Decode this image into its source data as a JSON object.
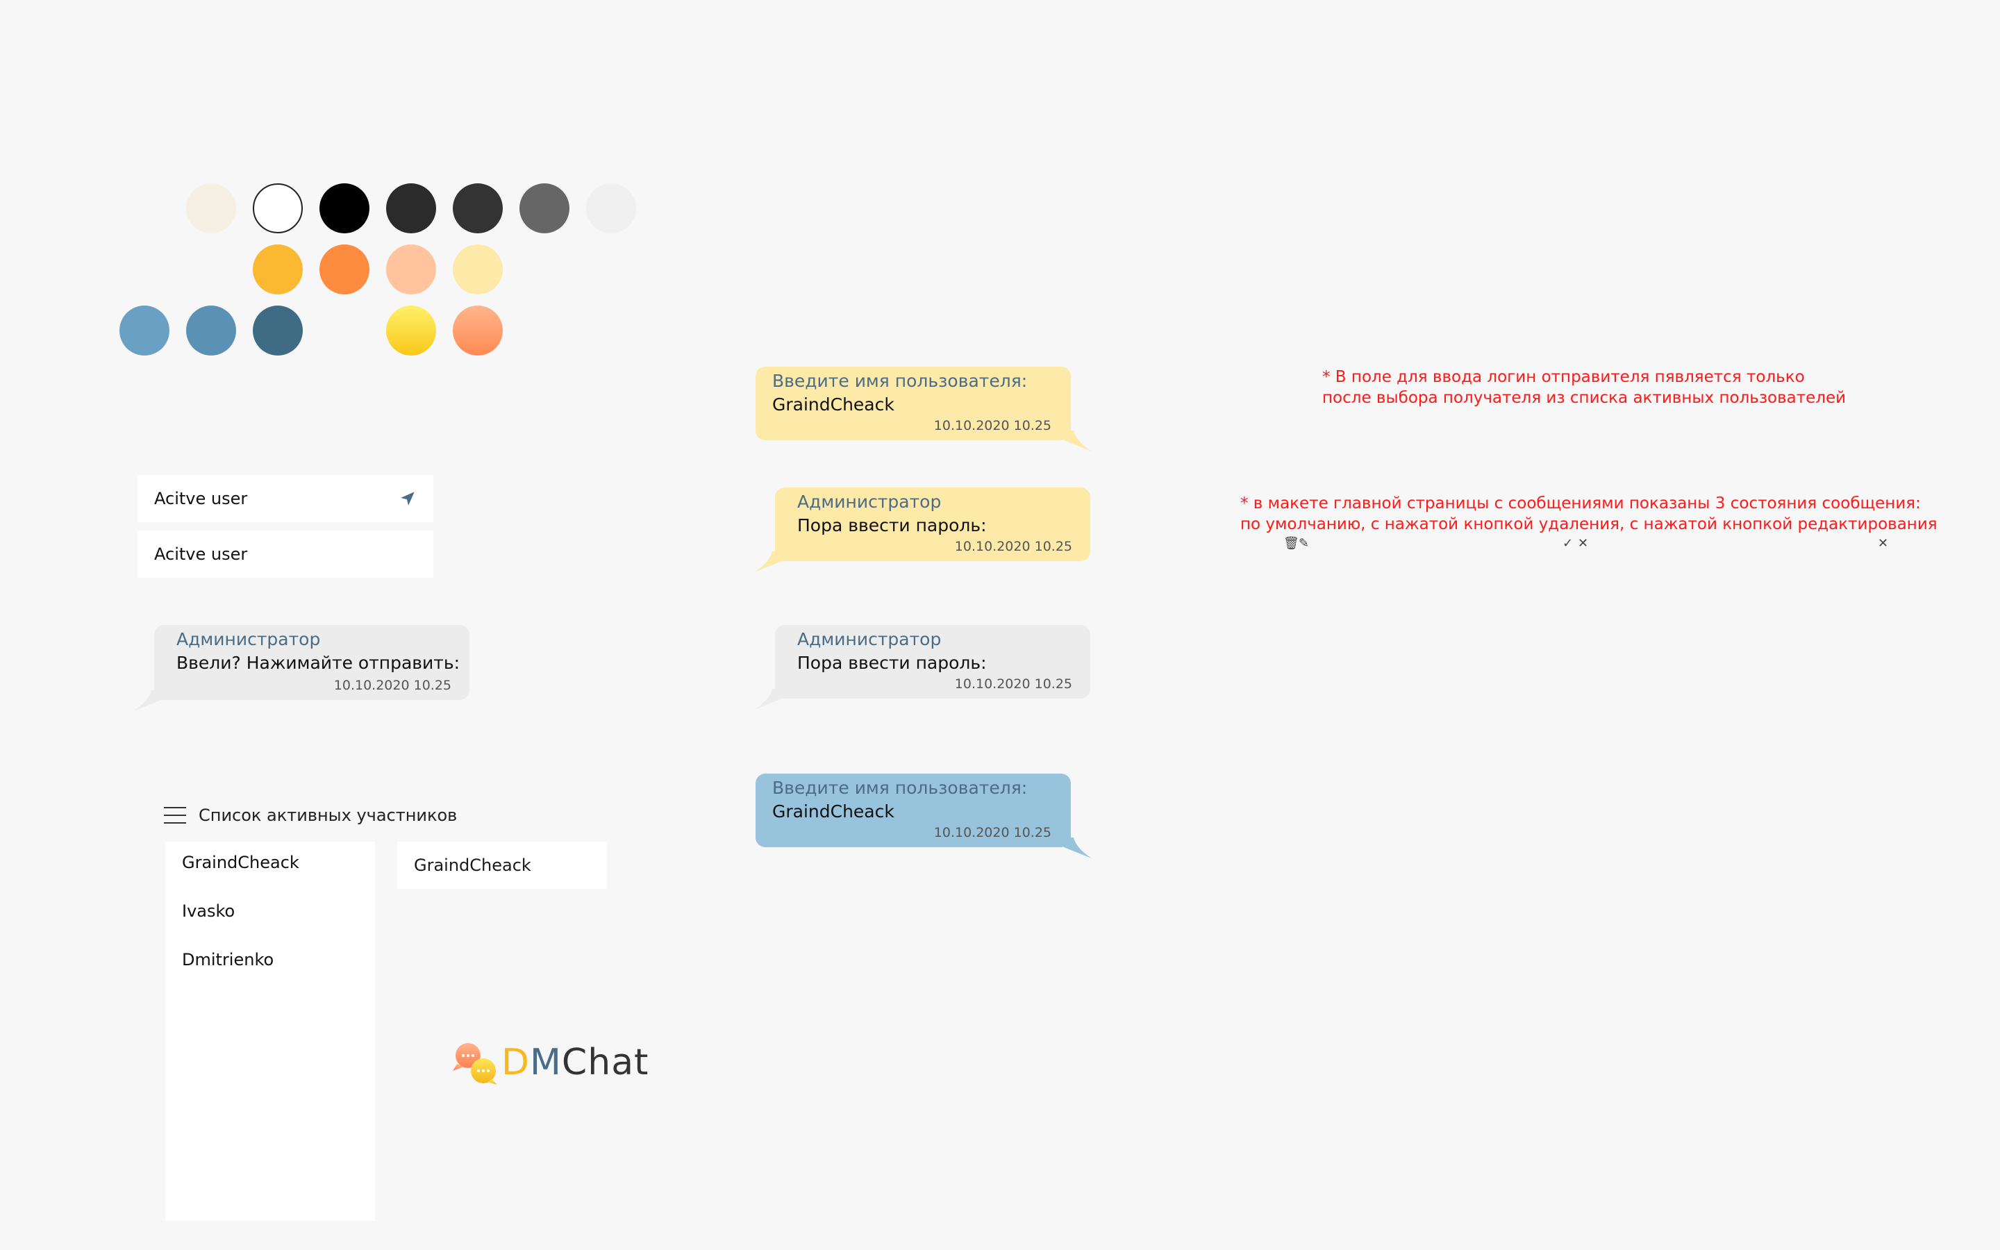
{
  "palette": {
    "row1": [
      "#f6efe3",
      "#ffffff",
      "#000000",
      "#2b2b2b",
      "#333333",
      "#666666",
      "#f0f0f0"
    ],
    "row2": [
      "#fbb833",
      "#fd8b40",
      "#ffc49e",
      "#fde9a8"
    ],
    "row3": [
      "#69a0c3",
      "#5b91b5",
      "#3f6b85",
      "gradient-yellow",
      "gradient-orange"
    ]
  },
  "active_users": {
    "item1": "Acitve user",
    "item2": "Acitve user"
  },
  "bubbles": {
    "b1": {
      "header": "Введите имя пользователя:",
      "body": "GraindCheack",
      "time": "10.10.2020 10.25"
    },
    "b2": {
      "header": "Администратор",
      "body": "Пора ввести пароль:",
      "time": "10.10.2020 10.25"
    },
    "b3": {
      "header": "Администратор",
      "body": "Пора ввести пароль:",
      "time": "10.10.2020 10.25"
    },
    "b4": {
      "header": "Введите имя пользователя:",
      "body": "GraindCheack",
      "time": "10.10.2020 10.25"
    },
    "b5": {
      "header": "Администратор",
      "body": "Ввели? Нажимайте отправить:",
      "time": "10.10.2020 10.25"
    }
  },
  "participants": {
    "title": "Список активных участников",
    "items": [
      "GraindCheack",
      "Ivasko",
      "Dmitrienko"
    ],
    "selected": "GraindCheack"
  },
  "logo": {
    "d": "D",
    "m": "M",
    "rest": "Chat"
  },
  "notes": {
    "note1": "* В поле для ввода логин отправителя пявляется только после выбора получателя из списка активных пользователей",
    "note2_line1": "* в макете главной страницы с сообщениями показаны 3 состояния сообщения:",
    "note2_line2": "по умолчанию, с нажатой кнопкой удаления, с нажатой кнопкой редактирования"
  },
  "colors": {
    "yellow_bubble": "#fde9a8",
    "grey_bubble": "#ececec",
    "blue_bubble": "#98c3dc",
    "accent_text": "#4a6c86",
    "note_red": "#ff1a1a"
  }
}
